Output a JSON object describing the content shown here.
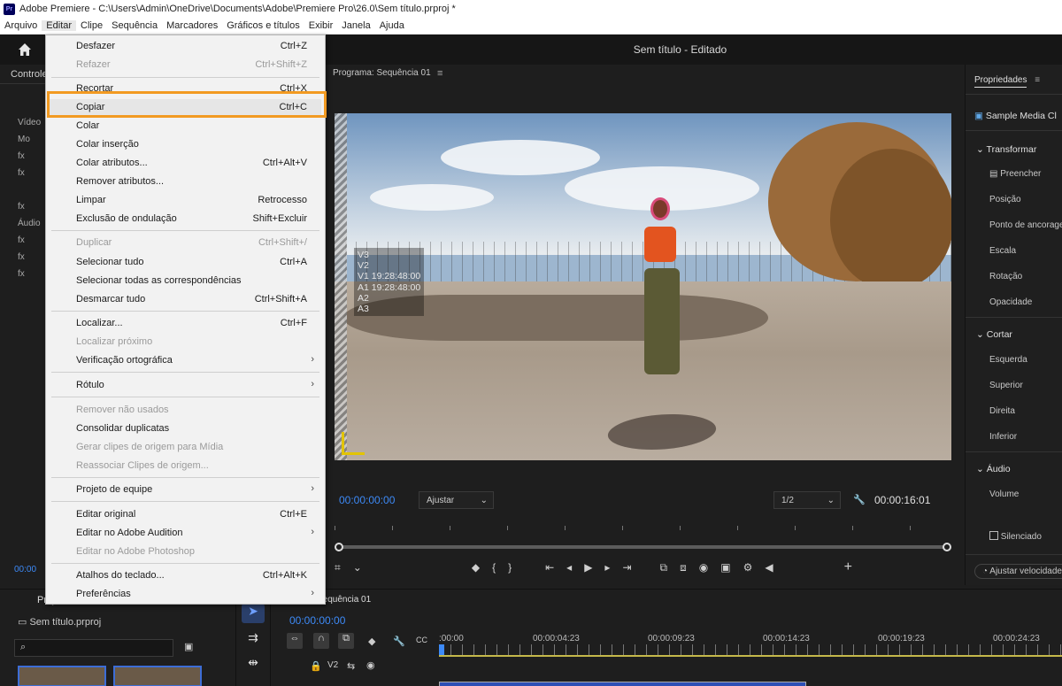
{
  "titlebar": {
    "title": "Adobe Premiere - C:\\Users\\Admin\\OneDrive\\Documents\\Adobe\\Premiere Pro\\26.0\\Sem título.prproj *",
    "logo": "Pr"
  },
  "menubar": [
    "Arquivo",
    "Editar",
    "Clipe",
    "Sequência",
    "Marcadores",
    "Gráficos e títulos",
    "Exibir",
    "Janela",
    "Ajuda"
  ],
  "header": {
    "doc_title": "Sem título - Editado"
  },
  "left_panel": {
    "tab": "Controle",
    "rows": [
      "Vídeo",
      "Mo",
      "fx",
      "fx",
      "",
      "fx",
      "Áudio",
      "fx",
      "fx",
      "fx"
    ],
    "timecode": "00:00"
  },
  "program": {
    "tab": "Programa: Sequência 01",
    "overlay": [
      "V3",
      "V2",
      "V1 19:28:48:00",
      "A1 19:28:48:00",
      "A2",
      "A3"
    ],
    "timecode_in": "00:00:00:00",
    "fit": "Ajustar",
    "resolution": "1/2",
    "timecode_out": "00:00:16:01",
    "playhead_position": 0,
    "controls": [
      "marker-icon",
      "in-icon",
      "out-icon",
      "step-back-icon",
      "play-icon",
      "step-forward-icon",
      "lift-icon",
      "extract-icon",
      "camera-icon",
      "add-icon"
    ]
  },
  "properties": {
    "tab": "Propriedades",
    "clip": "Sample Media Cl",
    "transform": "Transformar",
    "fill": "Preencher",
    "transform_rows": [
      "Posição",
      "Ponto de ancoragem",
      "Escala",
      "Rotação",
      "Opacidade"
    ],
    "crop": "Cortar",
    "crop_rows": [
      "Esquerda",
      "Superior",
      "Direita",
      "Inferior"
    ],
    "audio": "Áudio",
    "volume": "Volume",
    "mute": "Silenciado",
    "speed_button": "Ajustar velocidade"
  },
  "bottom": {
    "project_tab": "Proj",
    "project_file": "Sem título.prproj",
    "sequence_tab": "Sequência 01",
    "timeline_timecode": "00:00:00:00",
    "ruler_labels": [
      ":00:00",
      "00:00:04:23",
      "00:00:09:23",
      "00:00:14:23",
      "00:00:19:23",
      "00:00:24:23"
    ],
    "track": "V2"
  },
  "edit_menu": {
    "items": [
      {
        "label": "Desfazer",
        "shortcut": "Ctrl+Z",
        "disabled": false
      },
      {
        "label": "Refazer",
        "shortcut": "Ctrl+Shift+Z",
        "disabled": true
      },
      {
        "label": "Recortar",
        "shortcut": "Ctrl+X",
        "disabled": false
      },
      {
        "label": "Copiar",
        "shortcut": "Ctrl+C",
        "disabled": false
      },
      {
        "label": "Colar",
        "shortcut": "",
        "disabled": false
      },
      {
        "label": "Colar inserção",
        "shortcut": "",
        "disabled": false
      },
      {
        "label": "Colar atributos...",
        "shortcut": "Ctrl+Alt+V",
        "disabled": false
      },
      {
        "label": "Remover atributos...",
        "shortcut": "",
        "disabled": false
      },
      {
        "label": "Limpar",
        "shortcut": "Retrocesso",
        "disabled": false
      },
      {
        "label": "Exclusão de ondulação",
        "shortcut": "Shift+Excluir",
        "disabled": false
      },
      {
        "label": "Duplicar",
        "shortcut": "Ctrl+Shift+/",
        "disabled": true
      },
      {
        "label": "Selecionar tudo",
        "shortcut": "Ctrl+A",
        "disabled": false
      },
      {
        "label": "Selecionar todas as correspondências",
        "shortcut": "",
        "disabled": false
      },
      {
        "label": "Desmarcar tudo",
        "shortcut": "Ctrl+Shift+A",
        "disabled": false
      },
      {
        "label": "Localizar...",
        "shortcut": "Ctrl+F",
        "disabled": false
      },
      {
        "label": "Localizar próximo",
        "shortcut": "",
        "disabled": true
      },
      {
        "label": "Verificação ortográfica",
        "shortcut": "",
        "disabled": false
      },
      {
        "label": "Rótulo",
        "shortcut": "",
        "disabled": false
      },
      {
        "label": "Remover não usados",
        "shortcut": "",
        "disabled": true
      },
      {
        "label": "Consolidar duplicatas",
        "shortcut": "",
        "disabled": false
      },
      {
        "label": "Gerar clipes de origem para Mídia",
        "shortcut": "",
        "disabled": true
      },
      {
        "label": "Reassociar Clipes de origem...",
        "shortcut": "",
        "disabled": true
      },
      {
        "label": "Projeto de equipe",
        "shortcut": "",
        "disabled": false
      },
      {
        "label": "Editar original",
        "shortcut": "Ctrl+E",
        "disabled": false
      },
      {
        "label": "Editar no Adobe Audition",
        "shortcut": "",
        "disabled": false
      },
      {
        "label": "Editar no Adobe Photoshop",
        "shortcut": "",
        "disabled": true
      },
      {
        "label": "Atalhos do teclado...",
        "shortcut": "Ctrl+Alt+K",
        "disabled": false
      },
      {
        "label": "Preferências",
        "shortcut": "",
        "disabled": false
      }
    ]
  },
  "colors": {
    "accent_blue": "#3d8af7",
    "highlight": "#f29a22"
  }
}
